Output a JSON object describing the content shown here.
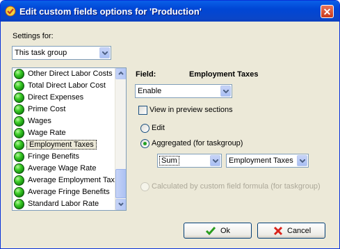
{
  "window": {
    "title": "Edit custom fields options for  'Production'",
    "close_symbol": "✕"
  },
  "settings": {
    "label": "Settings for:",
    "selected": "This task group"
  },
  "list": {
    "items": [
      "Other Direct Labor Costs",
      "Total Direct Labor Cost",
      "Direct Expenses",
      "Prime Cost",
      "Wages",
      "Wage Rate",
      "Employment Taxes",
      "Fringe Benefits",
      "Average Wage Rate",
      "Average Employment Taxes",
      "Average Fringe Benefits",
      "Standard Labor Rate"
    ],
    "selected_index": 6,
    "status_color": "#2fbf1f"
  },
  "field": {
    "label": "Field:",
    "name": "Employment Taxes"
  },
  "enable_combo": {
    "selected": "Enable"
  },
  "view_preview": {
    "label": "View in preview sections",
    "checked": false
  },
  "options": {
    "edit": "Edit",
    "aggregated": "Aggregated (for taskgroup)",
    "calculated": "Calculated by custom field formula (for taskgroup)",
    "selected": "aggregated"
  },
  "aggregate": {
    "function": "Sum",
    "field": "Employment Taxes"
  },
  "buttons": {
    "ok": "Ok",
    "cancel": "Cancel"
  },
  "colors": {
    "title_bar": "#0046d5",
    "dialog_bg": "#ece9d8",
    "ok_check": "#2a9d1e",
    "cancel_x": "#d9231b"
  }
}
